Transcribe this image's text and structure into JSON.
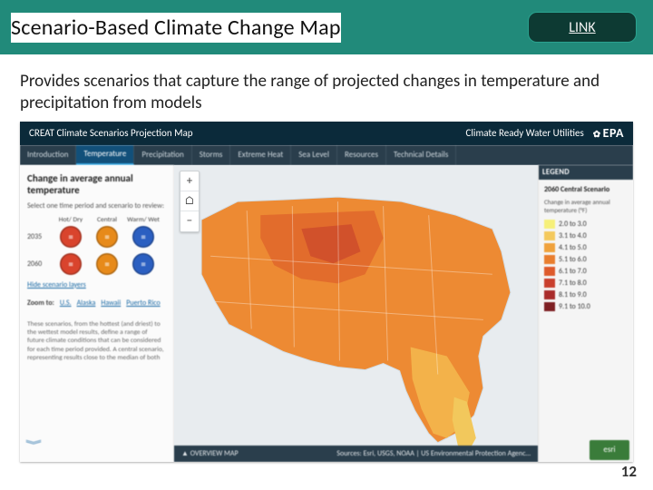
{
  "header": {
    "title": "Scenario-Based Climate Change Map",
    "link_label": "LINK"
  },
  "description": "Provides scenarios that capture the range of projected changes in temperature and precipitation from models",
  "embed": {
    "app_title": "CREAT Climate Scenarios Projection Map",
    "right_text": "Climate Ready Water Utilities",
    "epa_logo_text": "EPA",
    "tabs": [
      "Introduction",
      "Temperature",
      "Precipitation",
      "Storms",
      "Extreme Heat",
      "Sea Level",
      "Resources",
      "Technical Details"
    ],
    "active_tab_index": 1,
    "sidebar": {
      "title": "Change in average annual temperature",
      "select_line": "Select one time period and scenario to review:",
      "columns": [
        "Hot/\nDry",
        "Central",
        "Warm/\nWet"
      ],
      "rows": [
        {
          "year": "2035",
          "dots": [
            "r",
            "o",
            "b"
          ]
        },
        {
          "year": "2060",
          "dots": [
            "r",
            "o",
            "b"
          ]
        }
      ],
      "hide_link": "Hide scenario layers",
      "zoom_label": "Zoom to:",
      "zoom_targets": [
        "U.S.",
        "Alaska",
        "Hawaii",
        "Puerto Rico"
      ],
      "disclaimer": "These scenarios, from the hottest (and driest) to the wettest model results, define a range of future climate conditions that can be considered for each time period provided. A central scenario, representing results close to the median of both"
    },
    "map_controls": [
      "+",
      "⌂",
      "−"
    ],
    "legend": {
      "header": "LEGEND",
      "title": "2060 Central Scenario",
      "sub": "Change in average annual temperature (°F)",
      "items": [
        {
          "label": "2.0 to 3.0",
          "color": "#f6f07a"
        },
        {
          "label": "3.1 to 4.0",
          "color": "#f4c95d"
        },
        {
          "label": "4.1 to 5.0",
          "color": "#f0a23c"
        },
        {
          "label": "5.1 to 6.0",
          "color": "#e97e2e"
        },
        {
          "label": "6.1 to 7.0",
          "color": "#de5a2b"
        },
        {
          "label": "7.1 to 8.0",
          "color": "#c93f2d"
        },
        {
          "label": "8.1 to 9.0",
          "color": "#a92b2a"
        },
        {
          "label": "9.1 to 10.0",
          "color": "#7e1f23"
        }
      ]
    },
    "overview": {
      "left": "▲ OVERVIEW MAP",
      "right": "Sources: Esri, USGS, NOAA | US Environmental Protection Agenc…"
    },
    "esri_badge": "esri"
  },
  "page_number": "12"
}
